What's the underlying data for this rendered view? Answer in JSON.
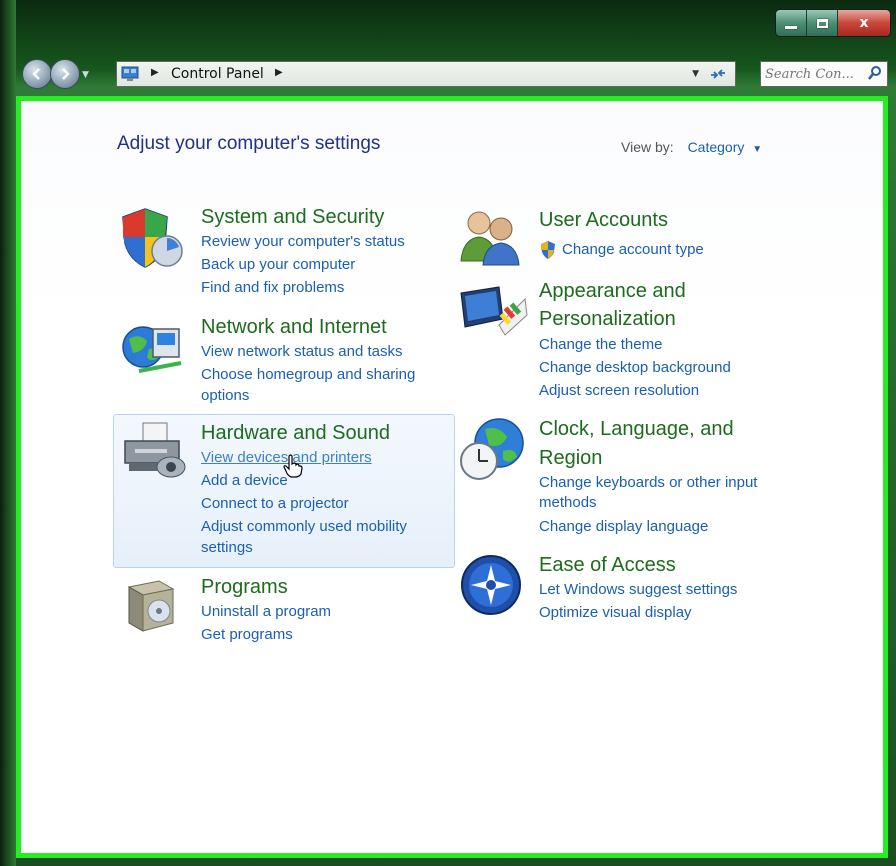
{
  "window": {
    "caption_buttons": {
      "close": "x"
    }
  },
  "nav": {
    "address_crumb": "Control Panel",
    "search_placeholder": "Search Con..."
  },
  "main": {
    "page_title": "Adjust your computer's settings",
    "view_by_label": "View by:",
    "view_by_value": "Category"
  },
  "categories": {
    "system_security": {
      "title": "System and Security",
      "links": [
        "Review your computer's status",
        "Back up your computer",
        "Find and fix problems"
      ]
    },
    "network_internet": {
      "title": "Network and Internet",
      "links": [
        "View network status and tasks",
        "Choose homegroup and sharing",
        "options"
      ]
    },
    "hardware_sound": {
      "title": "Hardware and Sound",
      "links": [
        "View devices and printers",
        "Add a device",
        "Connect to a projector",
        "Adjust commonly used mobility",
        "settings"
      ]
    },
    "programs": {
      "title": "Programs",
      "links": [
        "Uninstall a program",
        "Get programs"
      ]
    },
    "user_accounts": {
      "title": "User Accounts",
      "links": [
        "Change account type"
      ]
    },
    "appearance": {
      "title_line1": "Appearance and",
      "title_line2": "Personalization",
      "links": [
        "Change the theme",
        "Change desktop background",
        "Adjust screen resolution"
      ]
    },
    "clock": {
      "title_line1": "Clock, Language, and",
      "title_line2": "Region",
      "links": [
        "Change keyboards or other input",
        "methods",
        "Change display language"
      ]
    },
    "ease": {
      "title": "Ease of Access",
      "links": [
        "Let Windows suggest settings",
        "Optimize visual display"
      ]
    }
  },
  "colors": {
    "link": "#1b5fb0",
    "category_title": "#1e6b1e",
    "page_title": "#1e3287",
    "highlight_border": "#22ee22"
  },
  "icons": [
    "back-arrow-icon",
    "forward-arrow-icon",
    "control-panel-icon",
    "refresh-icon",
    "search-icon",
    "shield-icon",
    "network-globe-icon",
    "printer-icon",
    "programs-box-icon",
    "users-icon",
    "monitor-palette-icon",
    "globe-clock-icon",
    "ease-of-access-icon",
    "uac-shield-icon",
    "hand-cursor-icon"
  ]
}
